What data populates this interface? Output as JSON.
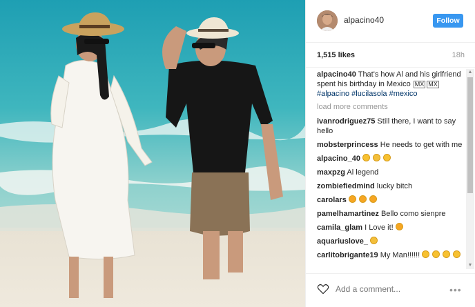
{
  "post": {
    "username": "alpacino40",
    "follow_label": "Follow",
    "likes": "1,515 likes",
    "time_ago": "18h"
  },
  "caption": {
    "username": "alpacino40",
    "text": "That's how Al and his girlfriend spent his birthday in Mexico",
    "flag_left": "MX",
    "flag_right": "MX",
    "hashtags": "#alpacino #lucilasola #mexico"
  },
  "load_more": "load more comments",
  "comments": [
    {
      "username": "ivanrodriguez75",
      "text": "Still there, I want to say hello"
    },
    {
      "username": "mobsterprincess",
      "text": "He needs to get with me"
    },
    {
      "username": "alpacino_40",
      "text": ""
    },
    {
      "username": "maxpzg",
      "text": "Al legend"
    },
    {
      "username": "zombiefiedmind",
      "text": "lucky bitch"
    },
    {
      "username": "carolars",
      "text": ""
    },
    {
      "username": "pamelhamartinez",
      "text": "Bello como sienpre"
    },
    {
      "username": "camila_glam",
      "text": "I Love it!"
    },
    {
      "username": "aquariuslove_",
      "text": ""
    },
    {
      "username": "carlitobrigante19",
      "text": "My Man!!!!!!"
    }
  ],
  "footer": {
    "add_comment_placeholder": "Add a comment..."
  },
  "icons": {
    "like": "heart-outline-icon",
    "more": "ellipsis-icon"
  },
  "colors": {
    "follow_button": "#3897f0",
    "hashtag": "#003569",
    "muted": "#999999"
  }
}
